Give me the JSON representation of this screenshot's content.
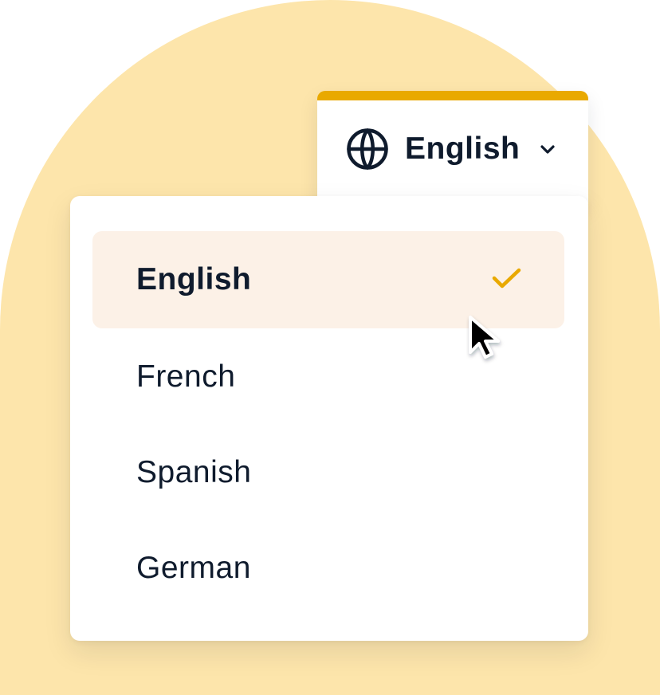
{
  "language_selector": {
    "current_label": "English",
    "icons": {
      "globe": "globe-icon",
      "chevron": "chevron-down-icon"
    }
  },
  "menu": {
    "options": [
      {
        "label": "English",
        "selected": true
      },
      {
        "label": "French",
        "selected": false
      },
      {
        "label": "Spanish",
        "selected": false
      },
      {
        "label": "German",
        "selected": false
      }
    ],
    "selected_icon": "check-icon"
  },
  "cursor": {
    "icon": "pointer-cursor-icon"
  },
  "colors": {
    "background_arch": "#fde5ab",
    "accent": "#e9a900",
    "selected_row": "#fcf1e7",
    "text": "#0f1b2d",
    "surface": "#ffffff"
  }
}
